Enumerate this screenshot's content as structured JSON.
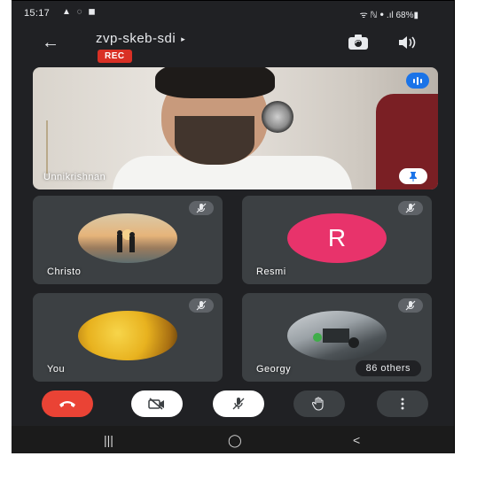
{
  "status_bar": {
    "time": "15:17",
    "left_icons": "▲ ◌ ◼",
    "right_info": "ᯤ ℕ ꔷ .ıl 68%▮"
  },
  "header": {
    "meeting_code": "zvp-skeb-sdi",
    "recording_badge": "REC"
  },
  "main_participant": {
    "name": "Unnikrishnan"
  },
  "participants": [
    {
      "name": "Christo"
    },
    {
      "name": "Resmi",
      "initial": "R"
    },
    {
      "name": "You"
    },
    {
      "name": "Georgy"
    }
  ],
  "others_label": "86 others",
  "colors": {
    "end_call": "#ea4335",
    "rec": "#d93025",
    "avatar_resmi": "#e8336b",
    "speaking_indicator": "#1a73e8"
  },
  "icons": {
    "back": "←",
    "title_caret": "▸",
    "nav_recents": "|||",
    "nav_home": "◯",
    "nav_back": "<"
  }
}
